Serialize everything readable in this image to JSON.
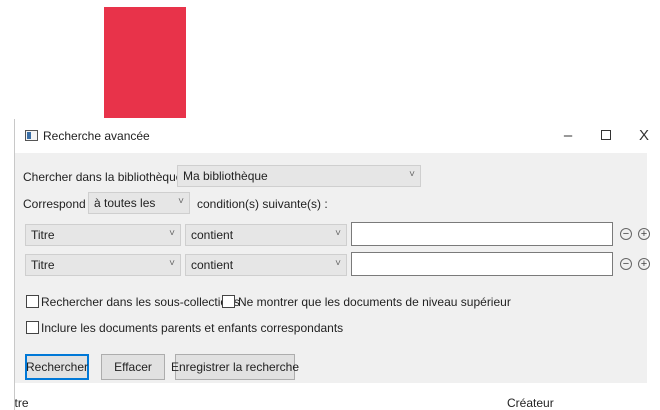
{
  "window": {
    "title": "Recherche avancée",
    "minimize_glyph": "–",
    "close_glyph": "X"
  },
  "library": {
    "label": "Chercher dans la bibliothèque :",
    "value": "Ma bibliothèque"
  },
  "match": {
    "label": "Correspond",
    "value": "à toutes les",
    "suffix": "condition(s) suivante(s) :"
  },
  "conditions": [
    {
      "field": "Titre",
      "operator": "contient",
      "value": ""
    },
    {
      "field": "Titre",
      "operator": "contient",
      "value": ""
    }
  ],
  "options": {
    "subcollections": {
      "label": "Rechercher dans les sous-collections",
      "checked": false
    },
    "top_level_only": {
      "label": "Ne montrer que les documents de niveau supérieur",
      "checked": false
    },
    "include_parents": {
      "label": "Inclure les documents parents et enfants correspondants",
      "checked": false
    }
  },
  "buttons": {
    "search": "Rechercher",
    "clear": "Effacer",
    "save": "Enregistrer la recherche"
  },
  "results": {
    "columns": [
      "Titre",
      "Créateur"
    ]
  },
  "icons": {
    "chevron": "˅",
    "remove": "−",
    "add": "+"
  },
  "colors": {
    "brand_block": "#e8334a",
    "panel_bg": "#f0f0f0",
    "default_button_border": "#0078d7"
  }
}
